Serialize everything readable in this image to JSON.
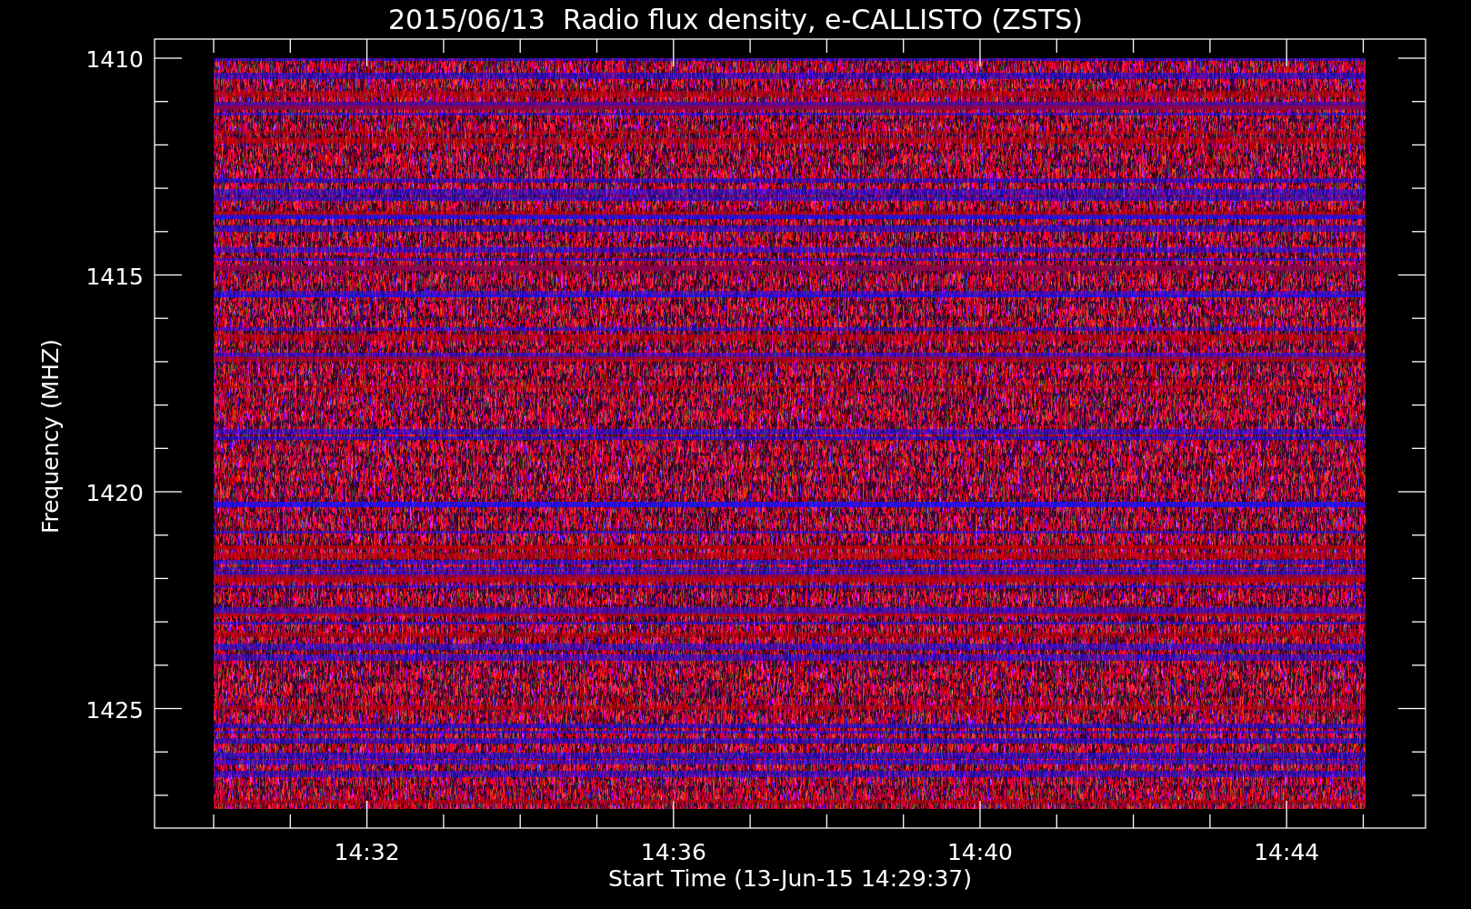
{
  "title": "2015/06/13  Radio flux density, e-CALLISTO (ZSTS)",
  "y_axis": {
    "label": "Frequency (MHZ)",
    "ticks": [
      "1410",
      "1415",
      "1420",
      "1425"
    ]
  },
  "x_axis": {
    "label": "Start Time (13-Jun-15 14:29:37)",
    "ticks": [
      "14:32",
      "14:36",
      "14:40",
      "14:44"
    ]
  }
}
